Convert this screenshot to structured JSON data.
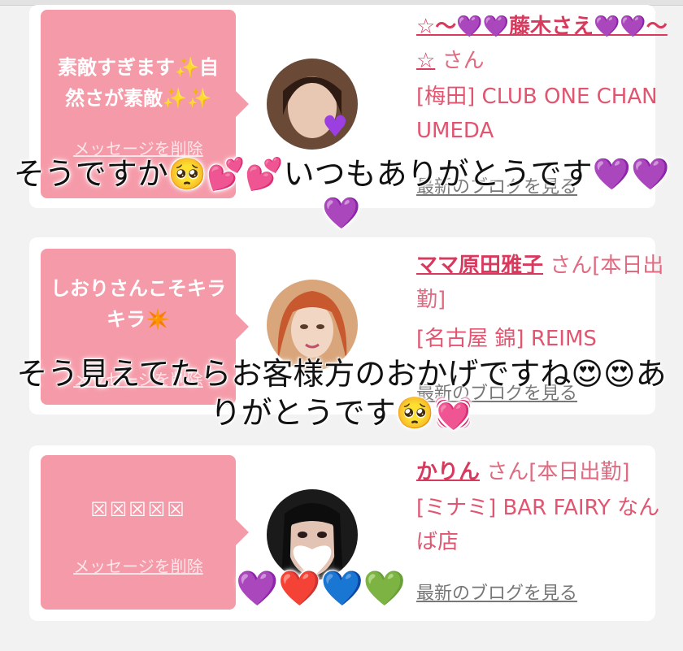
{
  "cards": [
    {
      "message": "素敵すぎます✨自然さが素敵✨✨",
      "delete_label": "メッセージを削除",
      "name": "☆〜💜💜藤木さえ💜💜〜☆",
      "suffix": "さん",
      "shop": "[梅田] CLUB ONE CHAN UMEDA",
      "blog": "最新のブログを見る"
    },
    {
      "message": "しおりさんこそキラキラ✴️",
      "delete_label": "メッセージを削除",
      "name": "ママ原田雅子",
      "suffix": "さん[本日出勤]",
      "shop": "[名古屋 錦] REIMS",
      "blog": "最新のブログを見る"
    },
    {
      "message": "☒☒☒☒☒",
      "delete_label": "メッセージを削除",
      "name": "かりん",
      "suffix": "さん[本日出勤]",
      "shop": "[ミナミ] BAR FAIRY なんば店",
      "blog": "最新のブログを見る"
    }
  ],
  "overlays": {
    "line1": "そうですか🥺💕💕いつもありがとうです💜💜💜",
    "line2": "そう見えてたらお客様方のおかげですね😍😍ありがとうです🥺💓",
    "line3": "💜❤️💙💚"
  },
  "colors": {
    "bubble": "#f59aa8",
    "name": "#d83a5e",
    "text": "#e05570"
  }
}
